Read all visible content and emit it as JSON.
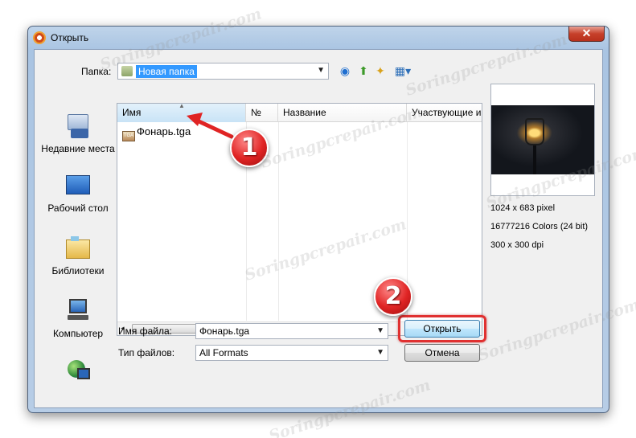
{
  "window": {
    "title": "Открыть"
  },
  "folder": {
    "label": "Папка:",
    "value": "Новая папка"
  },
  "places": [
    {
      "label": "Недавние места"
    },
    {
      "label": "Рабочий стол"
    },
    {
      "label": "Библиотеки"
    },
    {
      "label": "Компьютер"
    }
  ],
  "columns": [
    "Имя",
    "№",
    "Название",
    "Участвующие и"
  ],
  "files": [
    {
      "name": "Фонарь.tga"
    }
  ],
  "preview": {
    "info": [
      "1024 x 683 pixel",
      "16777216 Colors (24 bit)",
      "300 x 300 dpi"
    ]
  },
  "filename": {
    "label": "Имя файла:",
    "value": "Фонарь.tga"
  },
  "filetype": {
    "label": "Тип файлов:",
    "value": "All Formats"
  },
  "buttons": {
    "open": "Открыть",
    "cancel": "Отмена"
  },
  "annotations": {
    "step1": "1",
    "step2": "2",
    "arrow_color": "#e02424"
  },
  "watermark": "Soringpcrepair.com"
}
